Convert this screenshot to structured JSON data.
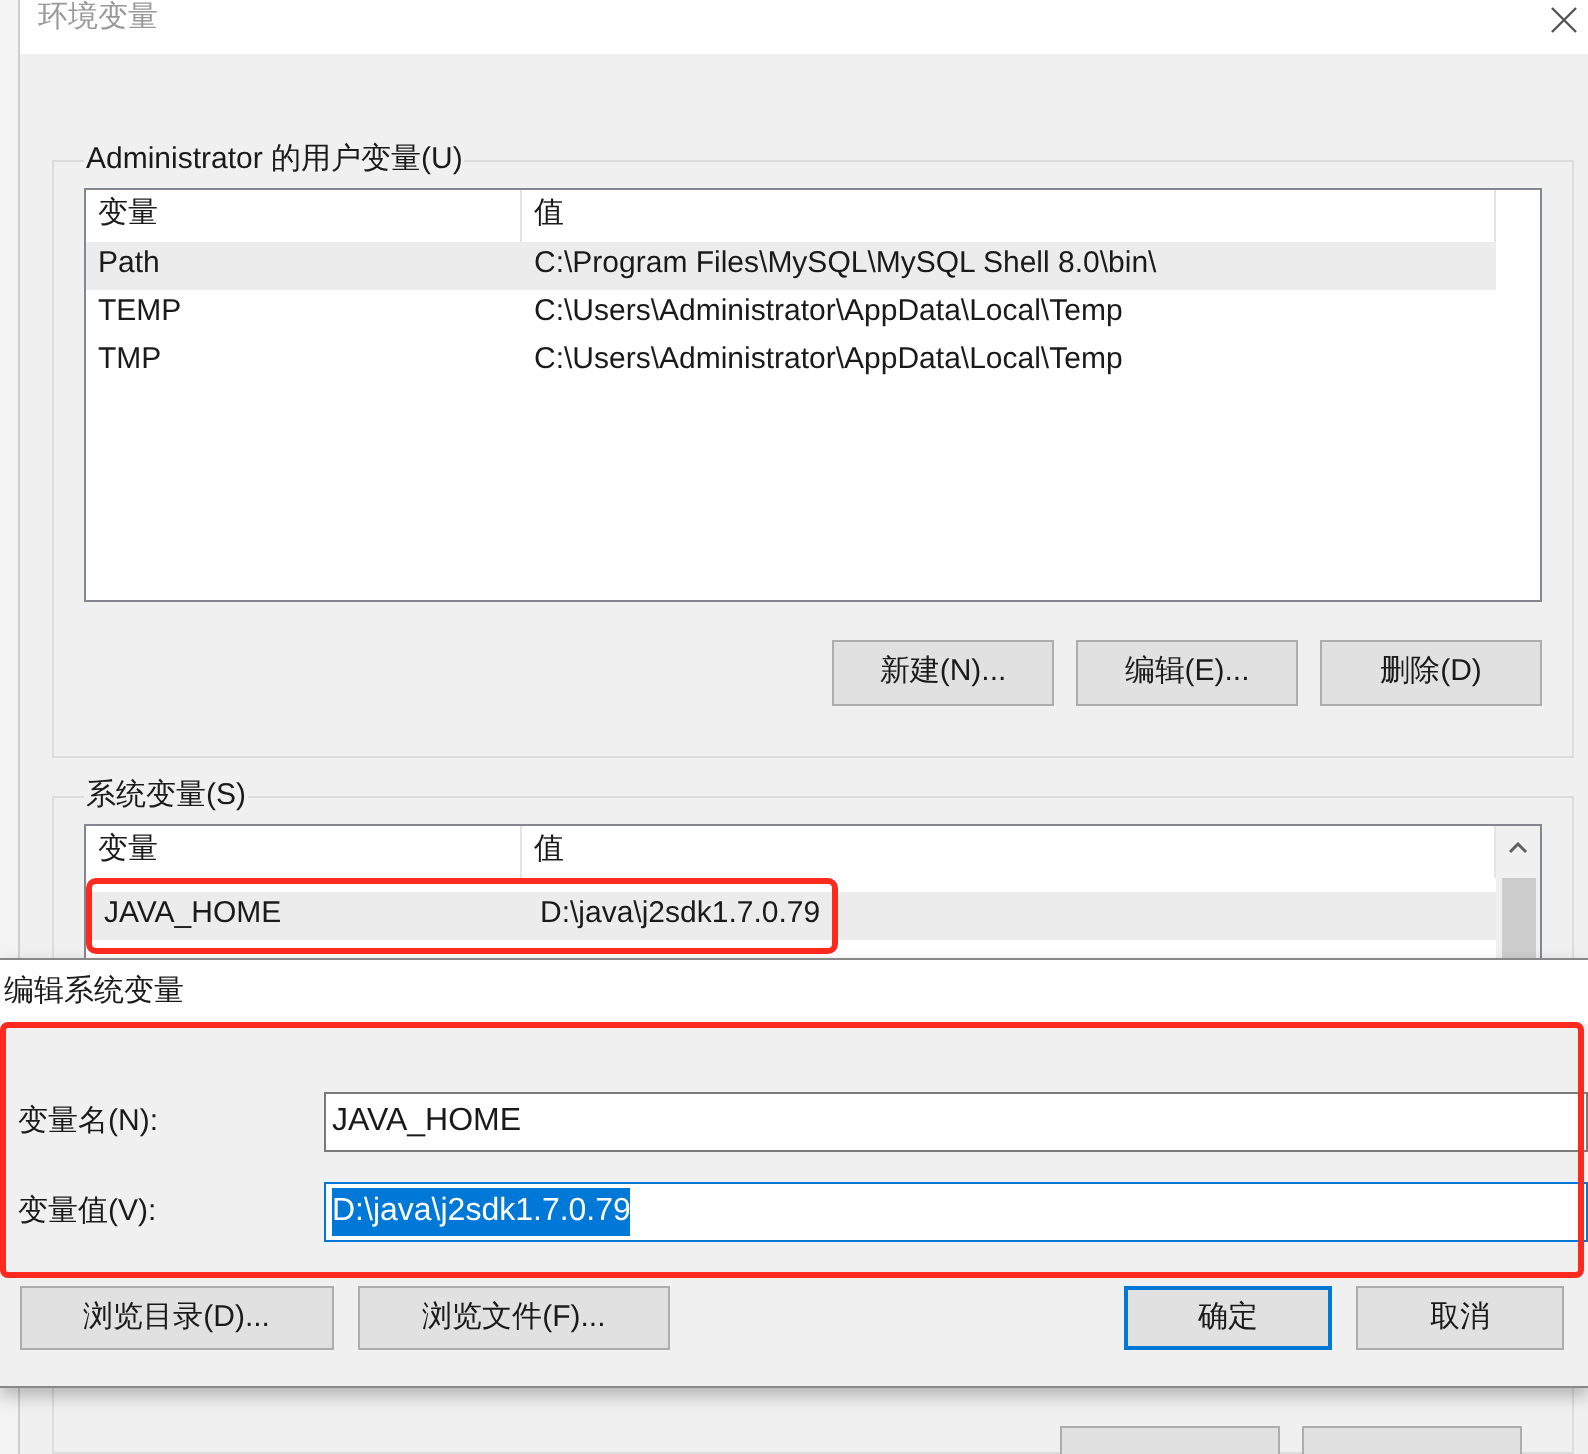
{
  "window": {
    "title": "环境变量"
  },
  "user_variables": {
    "title": "Administrator 的用户变量(U)",
    "columns": [
      "变量",
      "值"
    ],
    "rows": [
      {
        "name": "Path",
        "value": "C:\\Program Files\\MySQL\\MySQL Shell 8.0\\bin\\",
        "selected": true
      },
      {
        "name": "TEMP",
        "value": "C:\\Users\\Administrator\\AppData\\Local\\Temp",
        "selected": false
      },
      {
        "name": "TMP",
        "value": "C:\\Users\\Administrator\\AppData\\Local\\Temp",
        "selected": false
      }
    ],
    "buttons": [
      "新建(N)...",
      "编辑(E)...",
      "删除(D)"
    ]
  },
  "system_variables": {
    "title": "系统变量(S)",
    "columns": [
      "变量",
      "值"
    ],
    "rows": [
      {
        "name": "JAVA_HOME",
        "value": "D:\\java\\j2sdk1.7.0.79",
        "selected": true,
        "annotated": true
      }
    ]
  },
  "edit_dialog": {
    "title": "编辑系统变量",
    "annotated": true,
    "fields": [
      {
        "label": "变量名(N):",
        "value": "JAVA_HOME",
        "focused": false
      },
      {
        "label": "变量值(V):",
        "value": "D:\\java\\j2sdk1.7.0.79",
        "focused": true
      }
    ],
    "buttons": [
      {
        "label": "浏览目录(D)...",
        "default": false
      },
      {
        "label": "浏览文件(F)...",
        "default": false
      },
      {
        "label": "确定",
        "default": true
      },
      {
        "label": "取消",
        "default": false
      }
    ]
  }
}
